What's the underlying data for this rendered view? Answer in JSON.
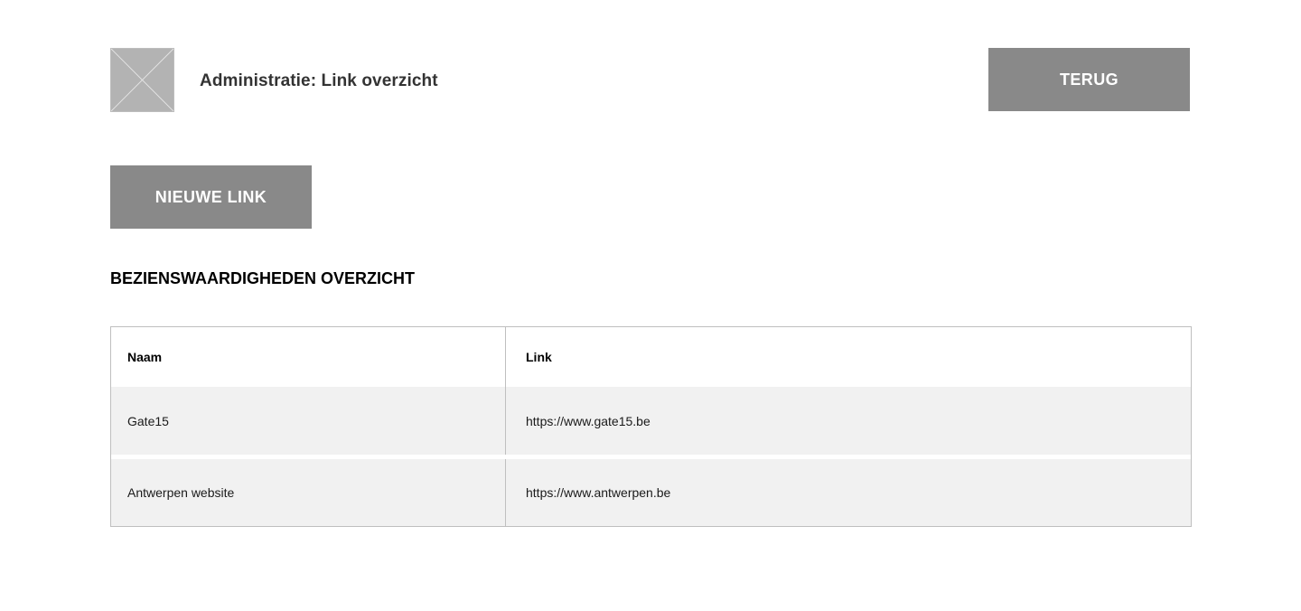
{
  "header": {
    "logo_icon": "image-placeholder-icon",
    "title": "Administratie: Link overzicht",
    "back_label": "TERUG"
  },
  "actions": {
    "new_link_label": "NIEUWE LINK"
  },
  "section": {
    "title": "BEZIENSWAARDIGHEDEN OVERZICHT"
  },
  "table": {
    "columns": [
      "Naam",
      "Link"
    ],
    "rows": [
      {
        "name": "Gate15",
        "link": "https://www.gate15.be"
      },
      {
        "name": "Antwerpen website",
        "link": "https://www.antwerpen.be"
      }
    ]
  },
  "colors": {
    "button_bg": "#898989",
    "row_bg": "#f1f1f1",
    "border": "#bfbfbf"
  }
}
